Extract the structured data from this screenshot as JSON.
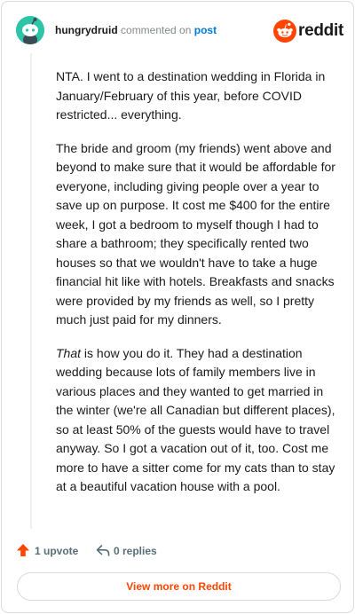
{
  "header": {
    "username": "hungrydruid",
    "verb": "commented on",
    "target": "post",
    "brand_name": "reddit"
  },
  "colors": {
    "brand": "#ff4500",
    "link": "#0079d3",
    "avatar_bg": "#2ec4a8",
    "muted": "#878a8c"
  },
  "icons": {
    "avatar": "snoo-avatar-icon",
    "brand": "reddit-logo-icon",
    "upvote": "upvote-arrow-icon",
    "reply": "reply-arrow-icon"
  },
  "comment": {
    "paragraph_1": "NTA. I went to a destination wedding in Florida in January/February of this year, before COVID restricted... everything.",
    "paragraph_2": "The bride and groom (my friends) went above and beyond to make sure that it would be affordable for everyone, including giving people over a year to save up on purpose. It cost me $400 for the entire week, I got a bedroom to myself though I had to share a bathroom; they specifically rented two houses so that we wouldn't have to take a huge financial hit like with hotels. Breakfasts and snacks were provided by my friends as well, so I pretty much just paid for my dinners.",
    "paragraph_3_emphasis": "That",
    "paragraph_3_rest": " is how you do it. They had a destination wedding because lots of family members live in various places and they wanted to get married in the winter (we're all Canadian but different places), so at least 50% of the guests would have to travel anyway. So I got a vacation out of it, too. Cost me more to have a sitter come for my cats than to stay at a beautiful vacation house with a pool."
  },
  "actions": {
    "upvotes": "1 upvote",
    "replies": "0 replies"
  },
  "footer": {
    "view_more": "View more on Reddit"
  }
}
